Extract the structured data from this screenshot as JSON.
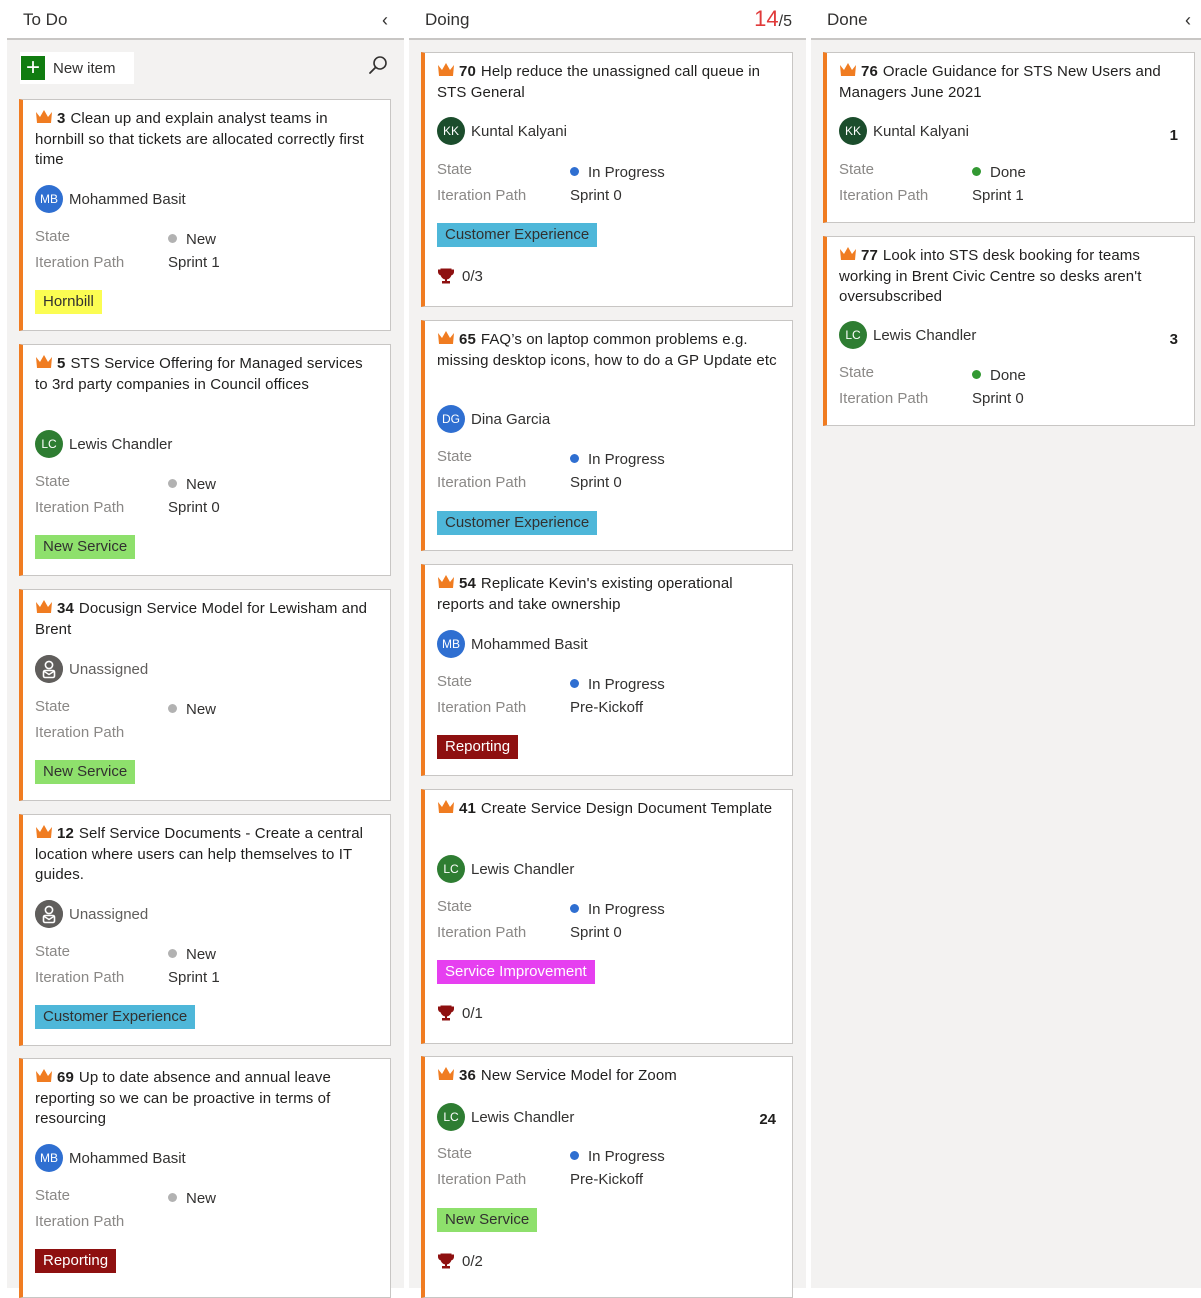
{
  "columns": {
    "todo": {
      "title": "To Do",
      "new_item_label": "New item"
    },
    "doing": {
      "title": "Doing",
      "wip_count": "14",
      "wip_sep": "/",
      "wip_limit": "5"
    },
    "done": {
      "title": "Done"
    }
  },
  "icons": {
    "collapse": "chevron-left-icon",
    "search": "search-icon",
    "add": "plus-icon",
    "work_item": "crown-icon",
    "checklist": "trophy-icon",
    "unassigned": "unassigned-user-icon"
  },
  "colors": {
    "card_accent": "#f07c21",
    "wip_over": "#e03a3a"
  },
  "labels": {
    "state": "State",
    "iteration": "Iteration Path"
  },
  "todo_cards": [
    {
      "id": "3",
      "title": "Clean up and explain analyst teams in hornbill so that tickets are allocated correctly first time",
      "initials": "MB",
      "assignee": "Mohammed Basit",
      "state": "New",
      "iteration": "Sprint 1",
      "tag": "Hornbill"
    },
    {
      "id": "5",
      "title": "STS Service Offering for Managed services to 3rd party companies in Council offices",
      "initials": "LC",
      "assignee": "Lewis Chandler",
      "state": "New",
      "iteration": "Sprint 0",
      "tag": "New Service"
    },
    {
      "id": "34",
      "title": "Docusign Service Model for Lewisham and Brent",
      "initials": "",
      "assignee": "Unassigned",
      "state": "New",
      "iteration": "",
      "tag": "New Service"
    },
    {
      "id": "12",
      "title": "Self Service Documents - Create a central location where users can help themselves to IT guides.",
      "initials": "",
      "assignee": "Unassigned",
      "state": "New",
      "iteration": "Sprint 1",
      "tag": "Customer Experience"
    },
    {
      "id": "69",
      "title": "Up to date absence and annual leave reporting so we can be proactive in terms of resourcing",
      "initials": "MB",
      "assignee": "Mohammed Basit",
      "state": "New",
      "iteration": "",
      "tag": "Reporting"
    }
  ],
  "doing_cards": [
    {
      "id": "70",
      "title": "Help reduce the unassigned call queue in STS General",
      "initials": "KK",
      "assignee": "Kuntal Kalyani",
      "state": "In Progress",
      "iteration": "Sprint 0",
      "tag": "Customer Experience",
      "checklist": "0/3"
    },
    {
      "id": "65",
      "title": "FAQ’s on laptop common problems e.g. missing desktop icons, how to do a GP Update etc",
      "initials": "DG",
      "assignee": "Dina Garcia",
      "state": "In Progress",
      "iteration": "Sprint 0",
      "tag": "Customer Experience"
    },
    {
      "id": "54",
      "title": "Replicate Kevin's existing operational reports and take ownership",
      "initials": "MB",
      "assignee": "Mohammed Basit",
      "state": "In Progress",
      "iteration": "Pre-Kickoff",
      "tag": "Reporting"
    },
    {
      "id": "41",
      "title": "Create Service Design Document Template",
      "initials": "LC",
      "assignee": "Lewis Chandler",
      "state": "In Progress",
      "iteration": "Sprint 0",
      "tag": "Service Improvement",
      "checklist": "0/1"
    },
    {
      "id": "36",
      "title": "New Service Model for Zoom",
      "initials": "LC",
      "assignee": "Lewis Chandler",
      "effort": "24",
      "state": "In Progress",
      "iteration": "Pre-Kickoff",
      "tag": "New Service",
      "checklist": "0/2"
    }
  ],
  "done_cards": [
    {
      "id": "76",
      "title": "Oracle Guidance for STS New Users and Managers June 2021",
      "initials": "KK",
      "assignee": "Kuntal Kalyani",
      "effort": "1",
      "state": "Done",
      "iteration": "Sprint 1"
    },
    {
      "id": "77",
      "title": "Look into STS desk booking for teams working in Brent Civic Centre so desks aren't oversubscribed",
      "initials": "LC",
      "assignee": "Lewis Chandler",
      "effort": "3",
      "state": "Done",
      "iteration": "Sprint 0"
    }
  ]
}
